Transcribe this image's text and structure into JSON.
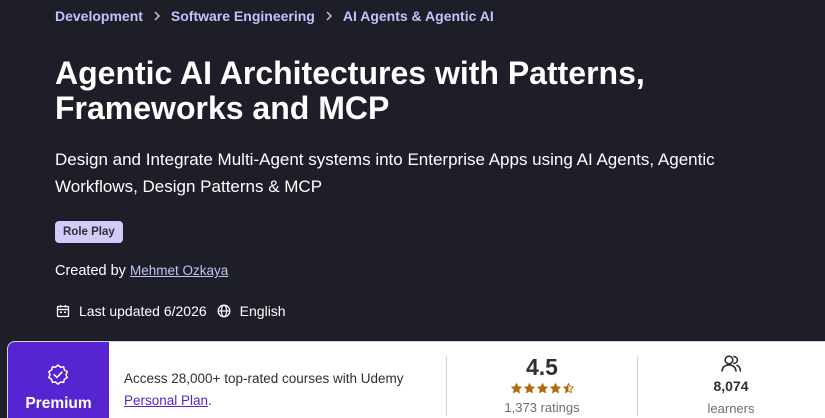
{
  "breadcrumb": {
    "items": [
      "Development",
      "Software Engineering",
      "AI Agents & Agentic AI"
    ]
  },
  "course": {
    "title": "Agentic AI Architectures with Patterns, Frameworks and MCP",
    "subtitle": "Design and Integrate Multi-Agent systems into Enterprise Apps using AI Agents, Agentic Workflows, Design Patterns & MCP",
    "badge": "Role Play",
    "created_by_label": "Created by",
    "instructor": "Mehmet Ozkaya",
    "last_updated": "Last updated 6/2026",
    "language": "English"
  },
  "premium_card": {
    "premium_label": "Premium",
    "access_text": "Access 28,000+ top-rated courses with Udemy",
    "plan_link": "Personal Plan",
    "period": ".",
    "rating_value": "4.5",
    "rating_stars": 4.5,
    "rating_count": "1,373 ratings",
    "learners_value": "8,074",
    "learners_label": "learners"
  },
  "colors": {
    "background": "#1d1e27",
    "link": "#c0c4fc",
    "badge": "#d1cbfa",
    "premium": "#5624d0",
    "star": "#b4690e"
  },
  "icons": {
    "breadcrumb_separator": "chevron-right-icon",
    "last_updated": "calendar-icon",
    "language": "globe-icon",
    "premium": "badge-check-icon",
    "learners": "people-icon"
  }
}
